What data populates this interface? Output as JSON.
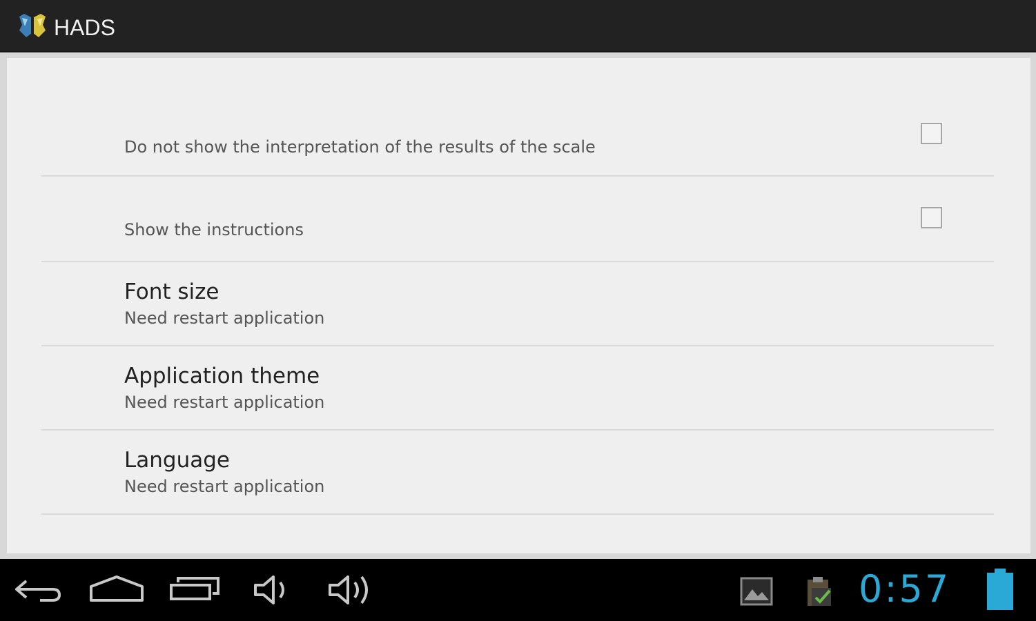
{
  "action_bar": {
    "title": "HADS",
    "icon": "butterfly-app-icon"
  },
  "preferences": [
    {
      "title": "",
      "summary": "Do not show the interpretation of the results of the scale",
      "checkbox": true,
      "checked": false
    },
    {
      "title": "",
      "summary": "Show the instructions",
      "checkbox": true,
      "checked": false
    },
    {
      "title": "Font size",
      "summary": "Need restart application",
      "checkbox": false
    },
    {
      "title": "Application theme",
      "summary": "Need restart application",
      "checkbox": false
    },
    {
      "title": "Language",
      "summary": "Need restart application",
      "checkbox": false
    }
  ],
  "nav_bar": {
    "buttons": [
      "back-icon",
      "home-icon",
      "recent-apps-icon",
      "volume-down-icon",
      "volume-up-icon"
    ]
  },
  "status_bar": {
    "icons": [
      "gallery-notification-icon",
      "clipboard-check-icon",
      "battery-icon"
    ],
    "clock": "0:57",
    "accent_color": "#2aa9d6"
  }
}
